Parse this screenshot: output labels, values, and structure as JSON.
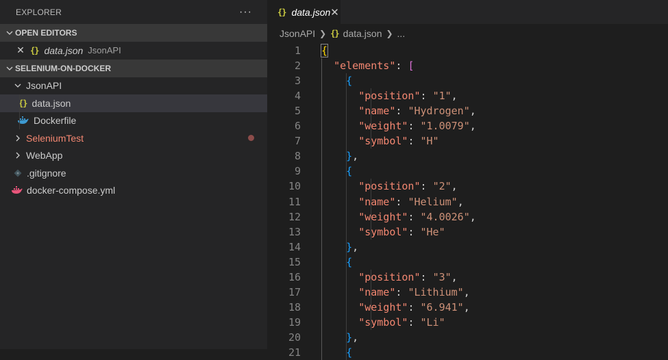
{
  "sidebar": {
    "title": "EXPLORER",
    "more_label": "···",
    "open_editors": {
      "header": "OPEN EDITORS",
      "items": [
        {
          "name": "data.json",
          "folder": "JsonAPI"
        }
      ]
    },
    "project": {
      "header": "SELENIUM-ON-DOCKER",
      "tree": {
        "jsonapi": "JsonAPI",
        "data_json": "data.json",
        "dockerfile": "Dockerfile",
        "seleniumtest": "SeleniumTest",
        "webapp": "WebApp",
        "gitignore": ".gitignore",
        "compose": "docker-compose.yml"
      }
    }
  },
  "editor": {
    "tab": {
      "title": "data.json",
      "close": "✕"
    },
    "breadcrumb": {
      "folder": "JsonAPI",
      "file": "data.json",
      "more": "..."
    },
    "elements_key": "elements",
    "lines": [
      "1",
      "2",
      "3",
      "4",
      "5",
      "6",
      "7",
      "8",
      "9",
      "10",
      "11",
      "12",
      "13",
      "14",
      "15",
      "16",
      "17",
      "18",
      "19",
      "20",
      "21"
    ],
    "items": [
      {
        "position": "1",
        "name": "Hydrogen",
        "weight": "1.0079",
        "symbol": "H"
      },
      {
        "position": "2",
        "name": "Helium",
        "weight": "4.0026",
        "symbol": "He"
      },
      {
        "position": "3",
        "name": "Lithium",
        "weight": "6.941",
        "symbol": "Li"
      }
    ]
  },
  "colors": {
    "sidebar_bg": "#252526",
    "editor_bg": "#1e1e1e",
    "key": "#f48771",
    "string": "#ce9178",
    "json_icon": "#cbcb41"
  }
}
